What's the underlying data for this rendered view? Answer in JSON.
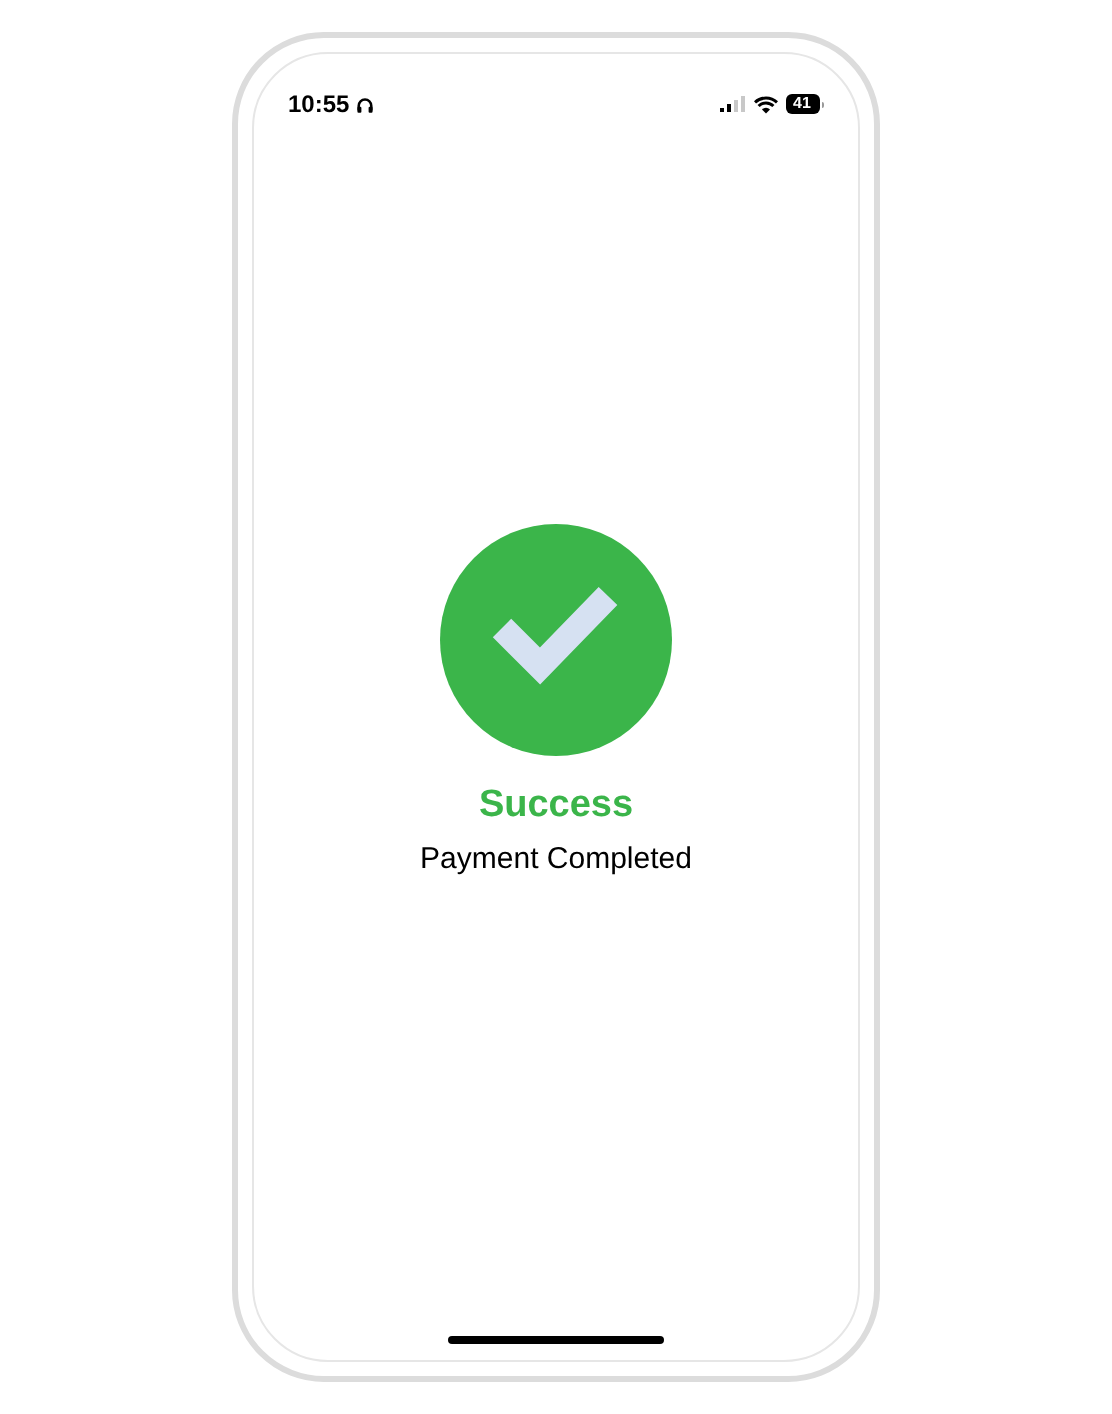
{
  "status_bar": {
    "time": "10:55",
    "battery": "41"
  },
  "result": {
    "title": "Success",
    "message": "Payment Completed"
  }
}
